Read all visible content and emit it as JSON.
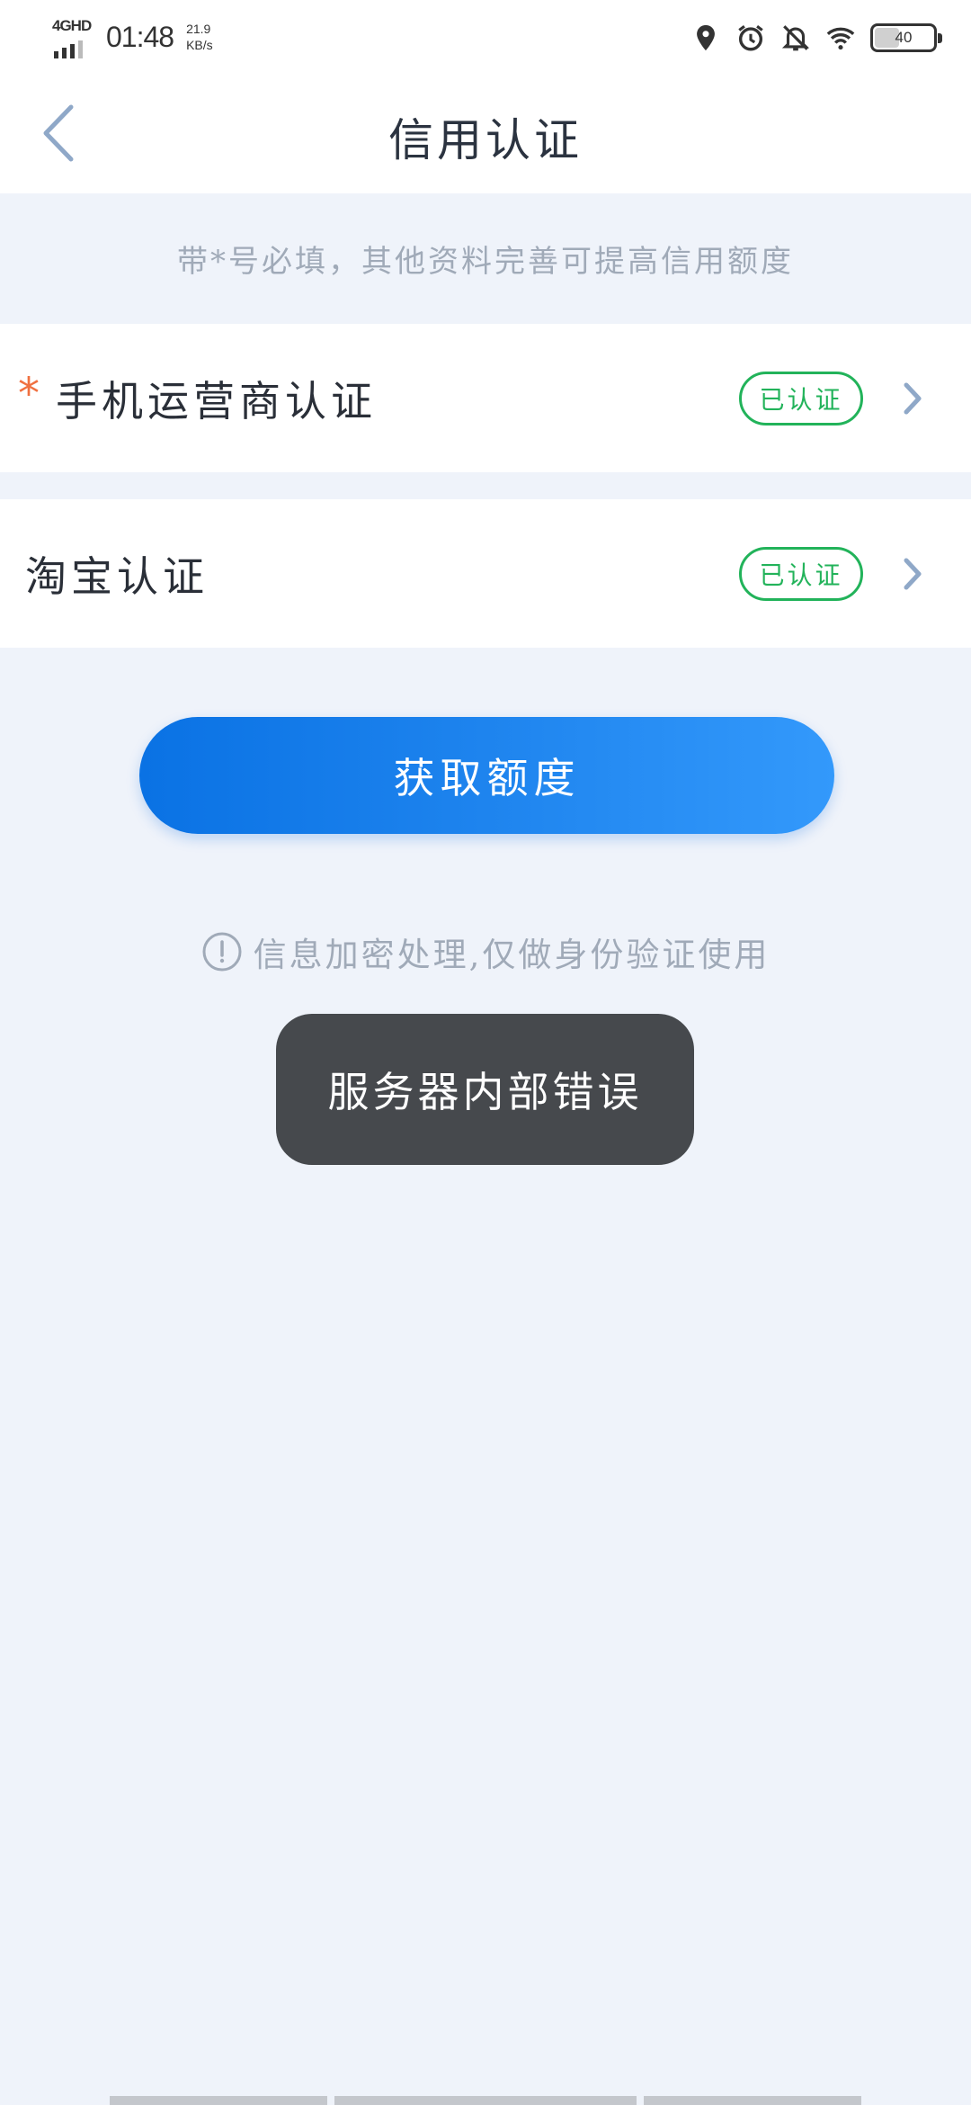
{
  "status_bar": {
    "network": "4GHD",
    "time": "01:48",
    "speed_value": "21.9",
    "speed_unit": "KB/s",
    "battery": "40",
    "icons": [
      "location-icon",
      "alarm-icon",
      "bell-off-icon",
      "wifi-icon",
      "battery-icon"
    ]
  },
  "header": {
    "title": "信用认证",
    "back_icon": "chevron-left-icon"
  },
  "hint": "带*号必填，其他资料完善可提高信用额度",
  "certifications": [
    {
      "label": "手机运营商认证",
      "required": true,
      "required_mark": "*",
      "status": "已认证"
    },
    {
      "label": "淘宝认证",
      "required": false,
      "status": "已认证"
    }
  ],
  "primary_button": {
    "label": "获取额度"
  },
  "security_note": {
    "icon": "info-circle-icon",
    "text": "信息加密处理,仅做身份验证使用"
  },
  "toast": {
    "message": "服务器内部错误"
  },
  "colors": {
    "accent": "#1a7ff0",
    "verified": "#22b35a",
    "required": "#f07040",
    "page_background": "#eff3fa",
    "toast_background": "#46494d"
  }
}
